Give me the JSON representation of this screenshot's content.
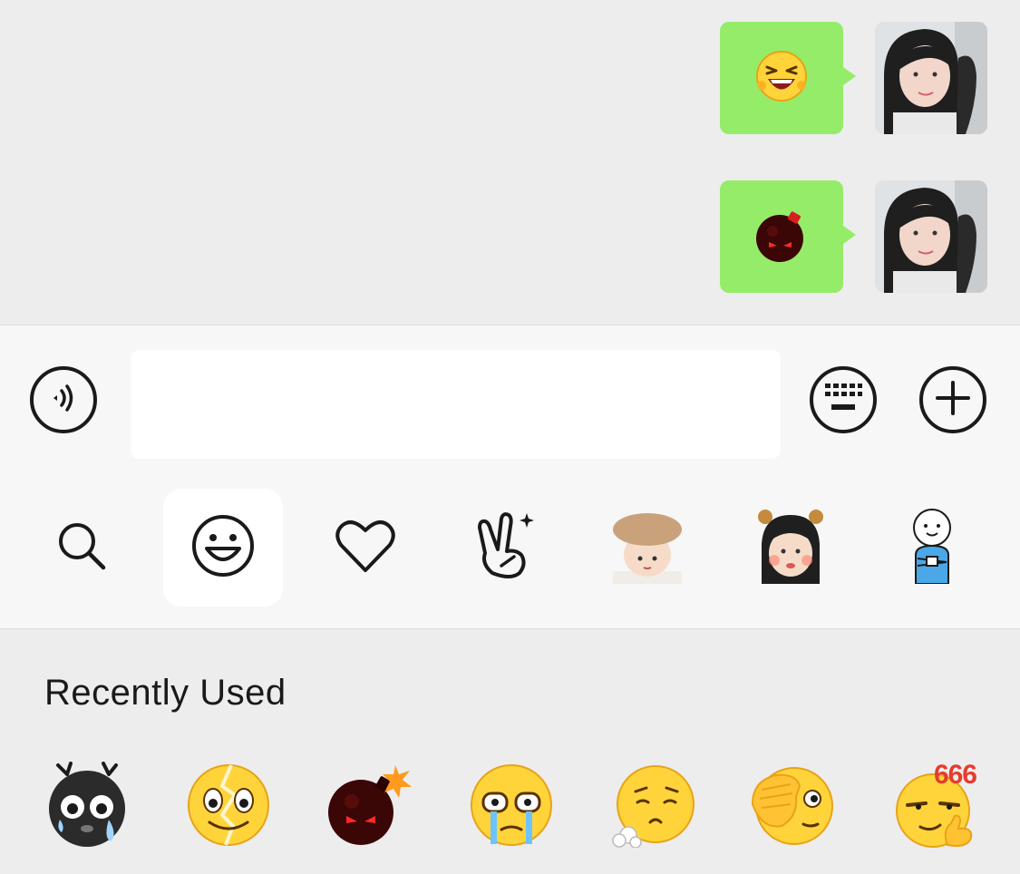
{
  "chat": {
    "messages": [
      {
        "sender": "me",
        "type": "sticker",
        "sticker_icon": "laughing-emoji-icon"
      },
      {
        "sender": "me",
        "type": "sticker",
        "sticker_icon": "bomb-emoji-icon"
      }
    ]
  },
  "input_bar": {
    "text_value": "",
    "voice_icon": "voice-icon",
    "keyboard_icon": "keyboard-icon",
    "plus_icon": "plus-icon"
  },
  "sticker_tabs": [
    {
      "icon": "search-icon",
      "active": false
    },
    {
      "icon": "smiley-icon",
      "active": true
    },
    {
      "icon": "heart-icon",
      "active": false
    },
    {
      "icon": "victory-hand-icon",
      "active": false
    },
    {
      "icon": "sticker-pack-baby-hat-icon",
      "active": false
    },
    {
      "icon": "sticker-pack-girl-icon",
      "active": false
    },
    {
      "icon": "sticker-pack-cartoon-man-icon",
      "active": false
    }
  ],
  "emoji_panel": {
    "section_title": "Recently Used",
    "recent": [
      {
        "icon": "crying-black-emoji-icon"
      },
      {
        "icon": "cracked-smile-emoji-icon"
      },
      {
        "icon": "bomb-emoji-icon"
      },
      {
        "icon": "tearful-emoji-icon"
      },
      {
        "icon": "sigh-emoji-icon"
      },
      {
        "icon": "facepalm-emoji-icon"
      },
      {
        "icon": "666-emoji-icon",
        "text": "666"
      }
    ]
  },
  "colors": {
    "chat_bg": "#ededed",
    "bubble": "#95ec69",
    "input_bar_bg": "#f7f7f7",
    "input_bg": "#ffffff",
    "icon_stroke": "#1a1a1a",
    "emoji_yellow": "#ffd43b"
  }
}
